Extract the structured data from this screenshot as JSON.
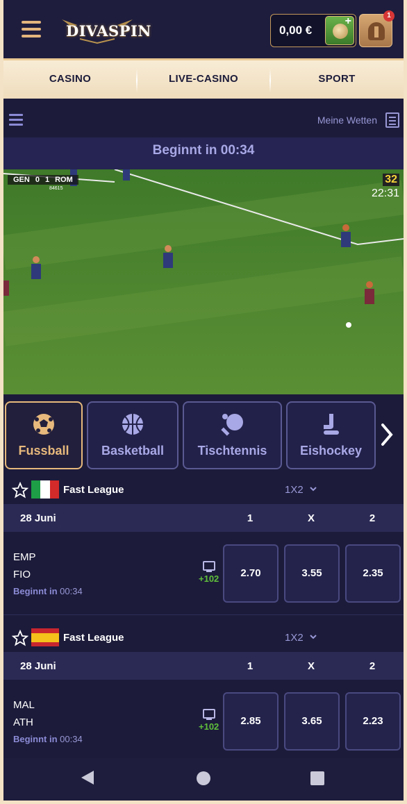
{
  "header": {
    "logo_text": "DIVASPIN",
    "balance": "0,00 €",
    "notification_count": "1"
  },
  "main_nav": {
    "items": [
      "CASINO",
      "LIVE-CASINO",
      "SPORT"
    ]
  },
  "sport_bar": {
    "my_bets_label": "Meine Wetten"
  },
  "countdown": {
    "text": "Beginnt in 00:34"
  },
  "video": {
    "home_team": "GEN",
    "away_team": "ROM",
    "home_score": "0",
    "away_score": "1",
    "event_id": "84615",
    "minute": "32",
    "clock": "22:31"
  },
  "sport_tabs": [
    {
      "label": "Fussball",
      "icon": "football-icon",
      "active": true
    },
    {
      "label": "Basketball",
      "icon": "basketball-icon",
      "active": false
    },
    {
      "label": "Tischtennis",
      "icon": "table-tennis-icon",
      "active": false
    },
    {
      "label": "Eishockey",
      "icon": "ice-hockey-icon",
      "active": false
    }
  ],
  "leagues": [
    {
      "name": "Fast League",
      "country_flag": "italy-flag",
      "flag_colors": [
        "#1e9e46",
        "#ffffff",
        "#d32a2a"
      ],
      "market": "1X2",
      "date": "28 Juni",
      "columns": [
        "1",
        "X",
        "2"
      ],
      "match": {
        "home": "EMP",
        "away": "FIO",
        "starts_label": "Beginnt in",
        "starts_time": "00:34",
        "more_markets": "+102",
        "odds": [
          "2.70",
          "3.55",
          "2.35"
        ]
      }
    },
    {
      "name": "Fast League",
      "country_flag": "spain-flag",
      "flag_colors": [
        "#c8262f",
        "#f4c21a",
        "#c8262f"
      ],
      "market": "1X2",
      "date": "28 Juni",
      "columns": [
        "1",
        "X",
        "2"
      ],
      "match": {
        "home": "MAL",
        "away": "ATH",
        "starts_label": "Beginnt in",
        "starts_time": "00:34",
        "more_markets": "+102",
        "odds": [
          "2.85",
          "3.65",
          "2.23"
        ]
      }
    }
  ],
  "colors": {
    "background": "#1c1b3a",
    "accent_gold": "#e7b97c",
    "accent_purple": "#9998d6",
    "green": "#5fbf3b"
  }
}
